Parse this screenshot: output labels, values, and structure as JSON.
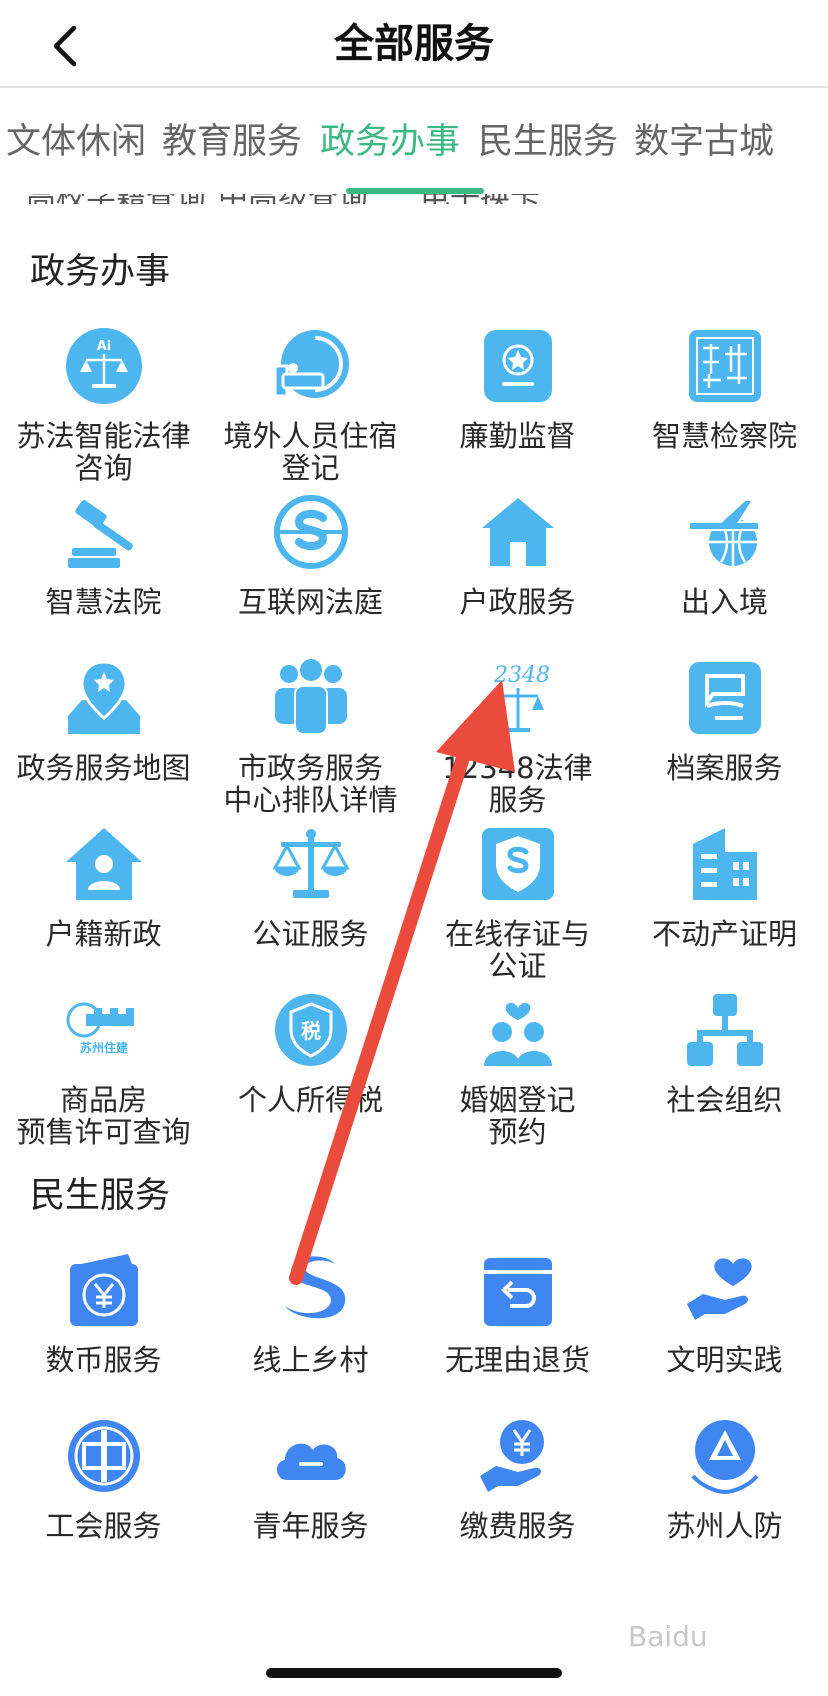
{
  "header": {
    "title": "全部服务"
  },
  "tabs": [
    "文体休闲",
    "教育服务",
    "政务办事",
    "民生服务",
    "数字古城"
  ],
  "active_tab": "政务办事",
  "accent_color": "#3cb983",
  "icon_color_light": "#4db6ee",
  "icon_color_dark": "#3f86f0",
  "sections": {
    "gov": {
      "title": "政务办事",
      "items": [
        {
          "label": "苏法智能法律咨询",
          "line1": "苏法智能法律",
          "line2": "咨询",
          "icon": "ai-scales-icon"
        },
        {
          "label": "境外人员住宿登记",
          "line1": "境外人员住宿",
          "line2": "登记",
          "icon": "globe-bed-icon"
        },
        {
          "label": "廉勤监督",
          "line1": "廉勤监督",
          "line2": "",
          "icon": "star-badge-icon"
        },
        {
          "label": "智慧检察院",
          "line1": "智慧检察院",
          "line2": "",
          "icon": "seal-stamp-icon"
        },
        {
          "label": "智慧法院",
          "line1": "智慧法院",
          "line2": "",
          "icon": "gavel-icon"
        },
        {
          "label": "互联网法庭",
          "line1": "互联网法庭",
          "line2": "",
          "icon": "network-court-icon"
        },
        {
          "label": "户政服务",
          "line1": "户政服务",
          "line2": "",
          "icon": "house-icon"
        },
        {
          "label": "出入境",
          "line1": "出入境",
          "line2": "",
          "icon": "airplane-globe-icon"
        },
        {
          "label": "政务服务地图",
          "line1": "政务服务地图",
          "line2": "",
          "icon": "map-pin-icon"
        },
        {
          "label": "市政务服务中心排队详情",
          "line1": "市政务服务",
          "line2": "中心排队详情",
          "icon": "people-group-icon"
        },
        {
          "label": "12348法律服务",
          "line1": "12348法律",
          "line2": "服务",
          "icon": "law-12348-icon"
        },
        {
          "label": "档案服务",
          "line1": "档案服务",
          "line2": "",
          "icon": "archive-seal-icon"
        },
        {
          "label": "户籍新政",
          "line1": "户籍新政",
          "line2": "",
          "icon": "house-person-icon"
        },
        {
          "label": "公证服务",
          "line1": "公证服务",
          "line2": "",
          "icon": "scales-icon"
        },
        {
          "label": "在线存证与公证",
          "line1": "在线存证与",
          "line2": "公证",
          "icon": "shield-s-icon"
        },
        {
          "label": "不动产证明",
          "line1": "不动产证明",
          "line2": "",
          "icon": "building-icon"
        },
        {
          "label": "商品房预售许可查询",
          "line1": "商品房",
          "line2": "预售许可查询",
          "icon": "suzhou-housing-icon"
        },
        {
          "label": "个人所得税",
          "line1": "个人所得税",
          "line2": "",
          "icon": "tax-shield-icon"
        },
        {
          "label": "婚姻登记预约",
          "line1": "婚姻登记",
          "line2": "预约",
          "icon": "couple-heart-icon"
        },
        {
          "label": "社会组织",
          "line1": "社会组织",
          "line2": "",
          "icon": "org-chart-icon"
        }
      ]
    },
    "life": {
      "title": "民生服务",
      "items": [
        {
          "label": "数币服务",
          "line1": "数币服务",
          "line2": "",
          "icon": "digital-yuan-icon"
        },
        {
          "label": "线上乡村",
          "line1": "线上乡村",
          "line2": "",
          "icon": "s-logo-icon"
        },
        {
          "label": "无理由退货",
          "line1": "无理由退货",
          "line2": "",
          "icon": "return-box-icon"
        },
        {
          "label": "文明实践",
          "line1": "文明实践",
          "line2": "",
          "icon": "hand-heart-icon"
        },
        {
          "label": "工会服务",
          "line1": "工会服务",
          "line2": "",
          "icon": "union-emblem-icon"
        },
        {
          "label": "青年服务",
          "line1": "青年服务",
          "line2": "",
          "icon": "cloud-icon"
        },
        {
          "label": "缴费服务",
          "line1": "缴费服务",
          "line2": "",
          "icon": "yuan-hand-icon"
        },
        {
          "label": "苏州人防",
          "line1": "苏州人防",
          "line2": "",
          "icon": "civil-defense-icon"
        }
      ]
    }
  },
  "peek_text": [
    "高校学籍查询",
    "中高级查询",
    "电子换卡"
  ]
}
